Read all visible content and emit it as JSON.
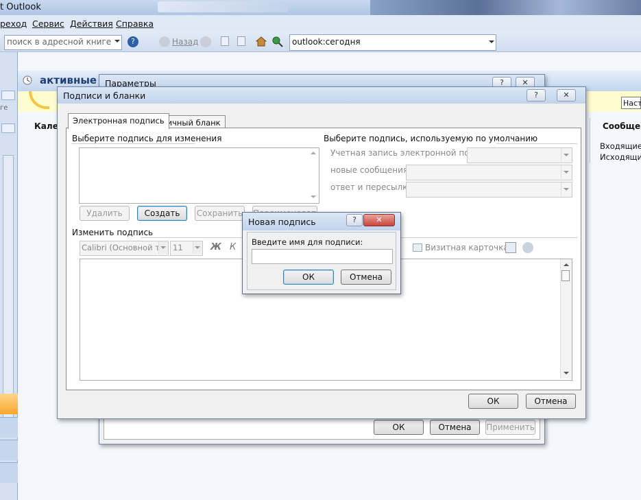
{
  "window": {
    "title": "t Outlook"
  },
  "menu": [
    "реход",
    "Сервис",
    "Действия",
    "Справка"
  ],
  "toolbar": {
    "address_book_placeholder": "поиск в адресной книге",
    "back_label": "Назад",
    "address_value": "outlook:сегодня"
  },
  "background": {
    "today_title": "активные -",
    "calendar_label": "Кален",
    "nav_right_header": "Сообщен",
    "inbox_label": "Входящие",
    "outbox_label": "Исходящие",
    "customize_label": "Наст",
    "small_text_left": "ге"
  },
  "options_dialog": {
    "title": "Параметры",
    "buttons": {
      "ok": "ОК",
      "cancel": "Отмена",
      "apply": "Применить"
    }
  },
  "signatures_dialog": {
    "title": "Подписи и бланки",
    "tabs": [
      "Электронная подпись",
      "Личный бланк"
    ],
    "select_signature_label": "Выберите подпись для изменения",
    "default_signature_label": "Выберите подпись, используемую по умолчанию",
    "email_account_label": "Учетная запись электронной почты:",
    "new_messages_label": "новые сообщения:",
    "replies_label": "ответ и пересылка:",
    "buttons": {
      "delete": "Удалить",
      "create": "Создать",
      "save": "Сохранить",
      "rename": "Переименовать"
    },
    "edit_signature_label": "Изменить подпись",
    "font_name": "Calibri (Основной текс",
    "font_size": "11",
    "bold_label": "Ж",
    "italic_label": "К",
    "business_card_label": "Визитная карточка",
    "footer_ok": "ОК",
    "footer_cancel": "Отмена"
  },
  "new_signature_dialog": {
    "title": "Новая подпись",
    "prompt": "Введите имя для подписи:",
    "input_value": "",
    "ok": "ОК",
    "cancel": "Отмена"
  },
  "colors": {
    "accent": "#3c7fb1",
    "titlebar": "#c1d3ec",
    "close_red": "#c9463d"
  }
}
